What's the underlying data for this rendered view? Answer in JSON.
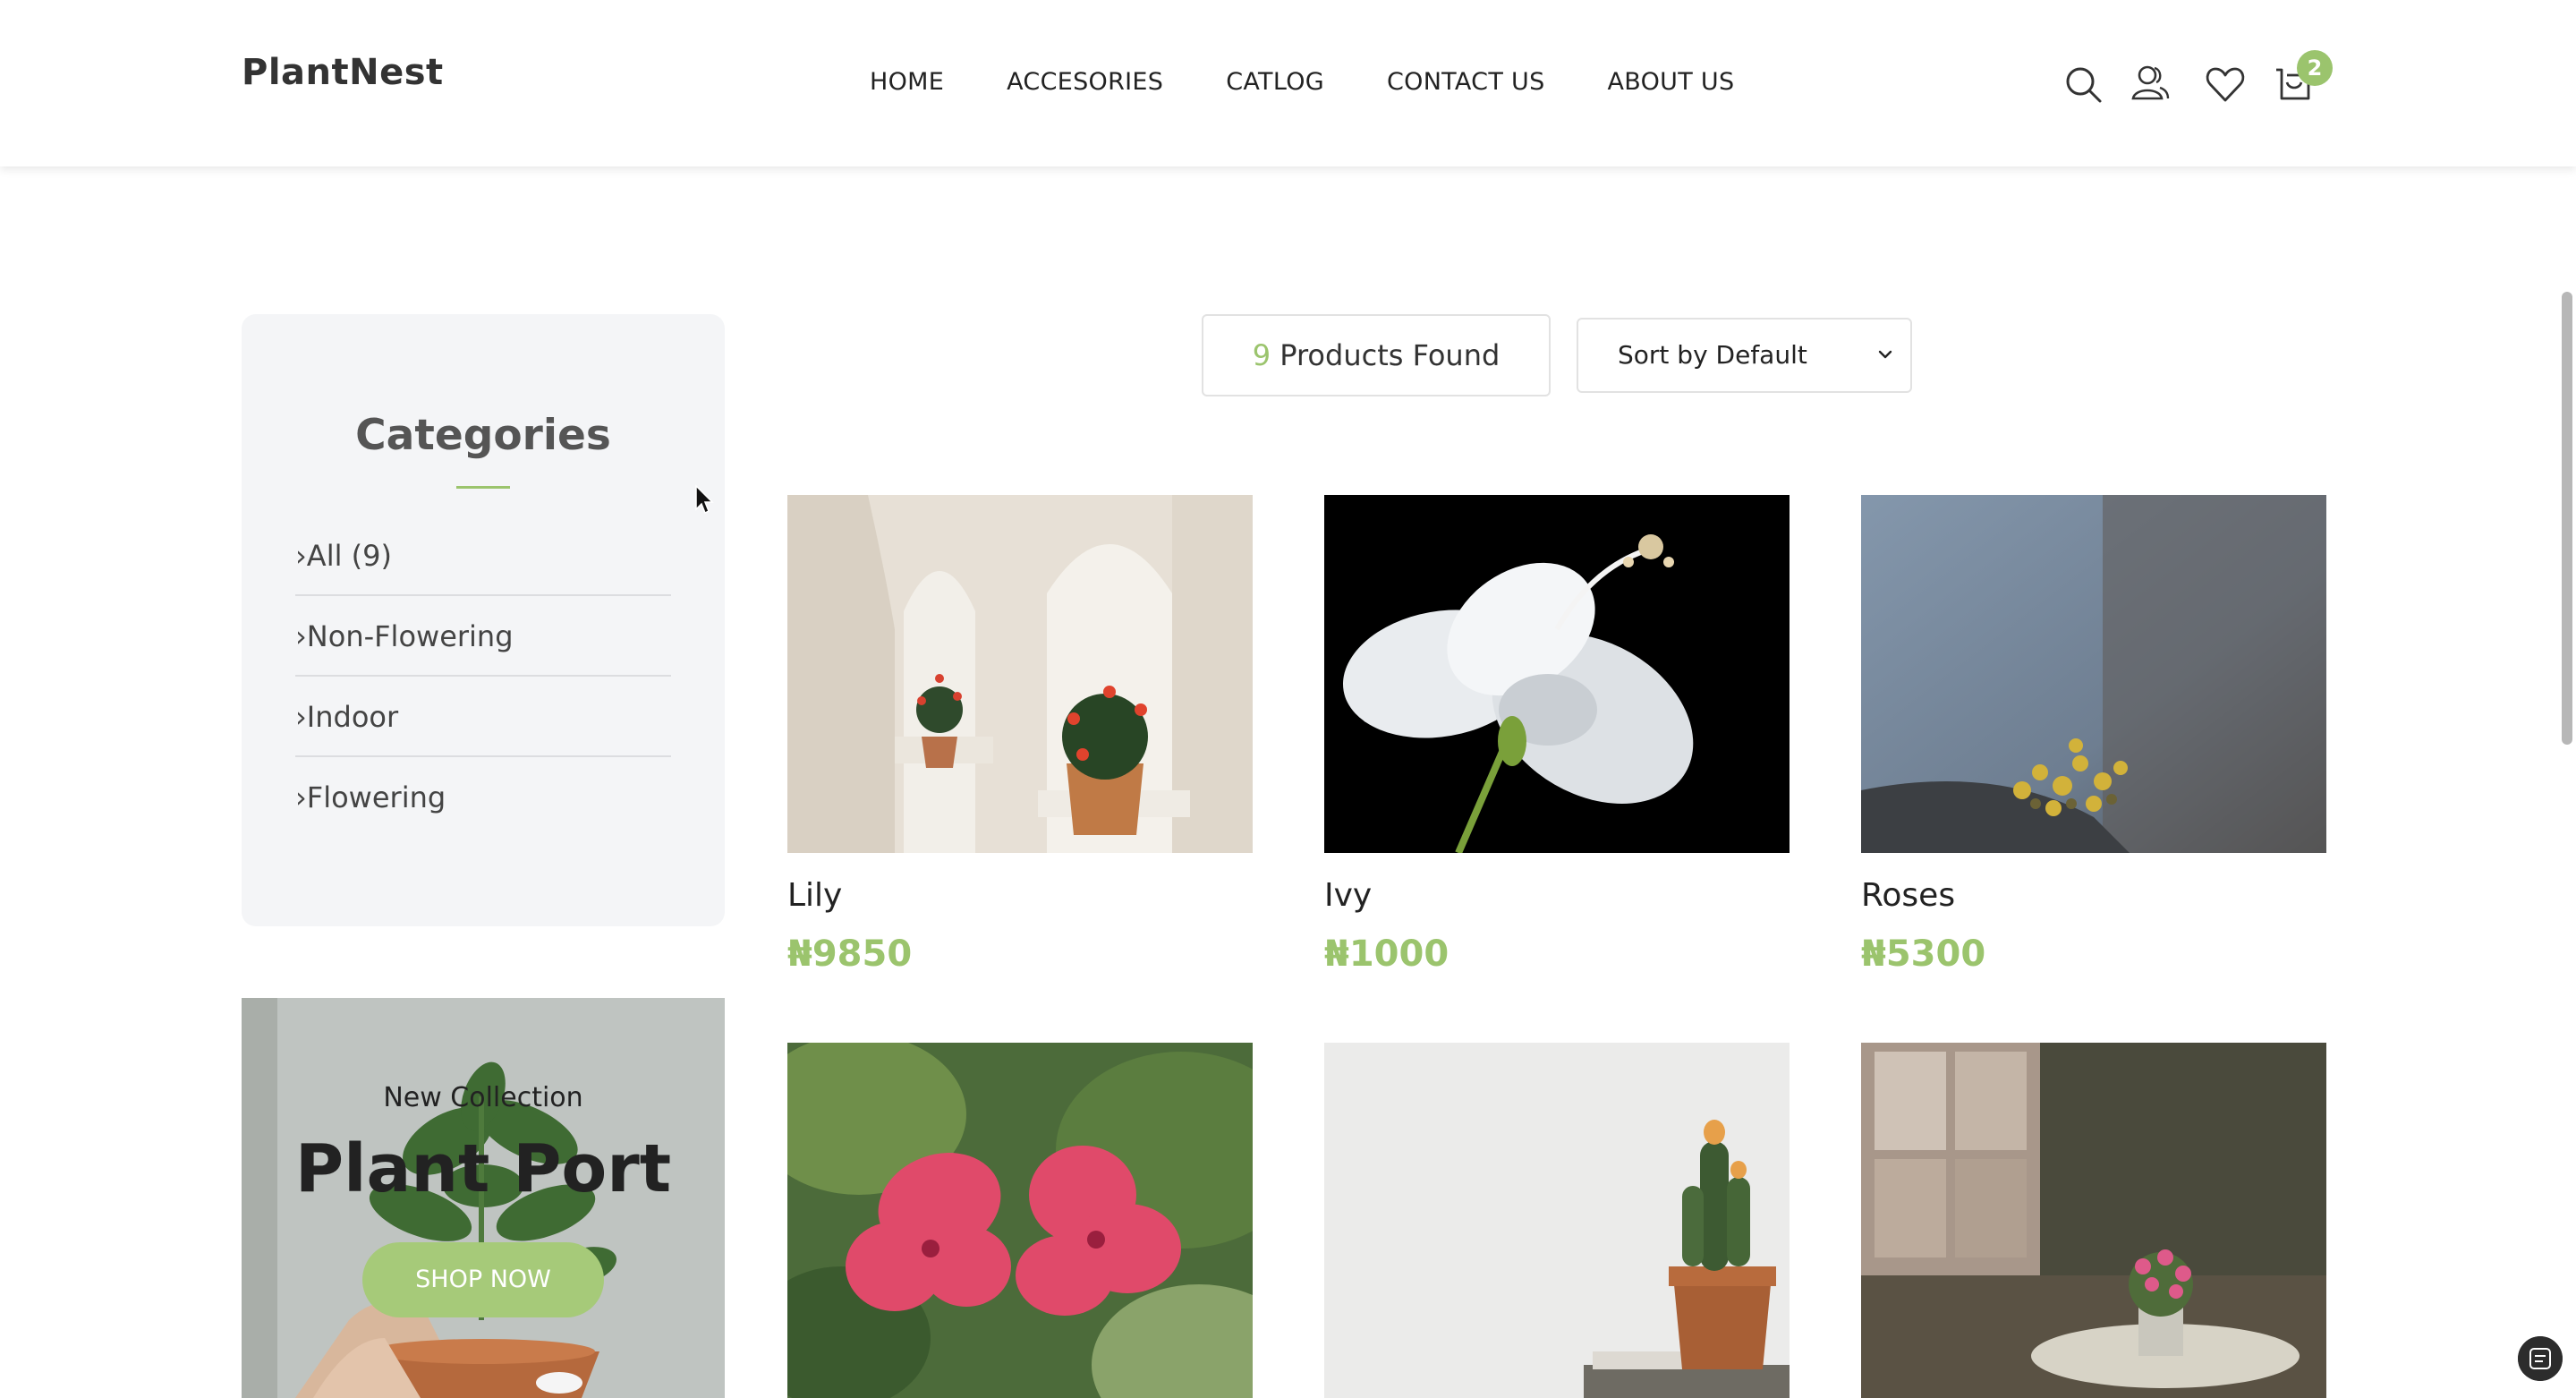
{
  "brand": {
    "name": "PlantNest",
    "accent_color": "#9bc46d"
  },
  "nav": {
    "items": [
      {
        "label": "HOME"
      },
      {
        "label": "ACCESORIES"
      },
      {
        "label": "CATLOG"
      },
      {
        "label": "CONTACT US"
      },
      {
        "label": "ABOUT US"
      }
    ]
  },
  "header_icons": {
    "search": "search-icon",
    "account": "user-icon",
    "wishlist": "heart-icon",
    "cart": "cart-icon",
    "cart_count": "2"
  },
  "sidebar": {
    "title": "Categories",
    "categories": [
      {
        "label": "All (9)"
      },
      {
        "label": "Non-Flowering"
      },
      {
        "label": "Indoor"
      },
      {
        "label": "Flowering"
      }
    ],
    "promo": {
      "subtitle": "New Collection",
      "title": "Plant Port",
      "button": "SHOP NOW"
    }
  },
  "toolbar": {
    "found_count": "9",
    "found_label": "Products Found",
    "sort_selected": "Sort by Default"
  },
  "products": [
    {
      "name": "Lily",
      "price": "₦9850"
    },
    {
      "name": "Ivy",
      "price": "₦1000"
    },
    {
      "name": "Roses",
      "price": "₦5300"
    },
    {
      "name": "",
      "price": ""
    },
    {
      "name": "",
      "price": ""
    },
    {
      "name": "",
      "price": ""
    }
  ]
}
